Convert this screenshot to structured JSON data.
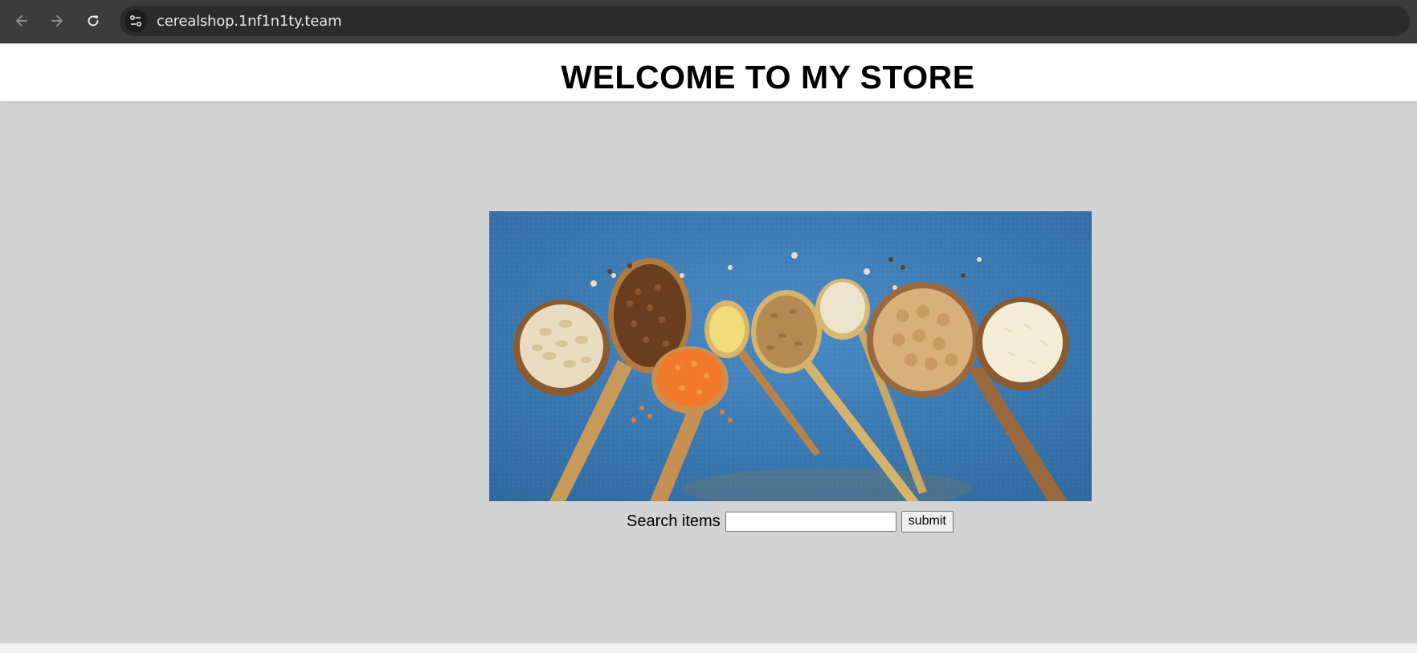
{
  "browser": {
    "url": "cerealshop.1nf1n1ty.team",
    "back_icon": "arrow-left-icon",
    "forward_icon": "arrow-right-icon",
    "reload_icon": "reload-icon",
    "site_info_icon": "tune-icon"
  },
  "header": {
    "title": "WELCOME TO MY STORE"
  },
  "search": {
    "label": "Search items",
    "value": "",
    "placeholder": "",
    "submit_label": "submit"
  },
  "colors": {
    "toolbar": "#3c3c3c",
    "main_background": "#d3d3d3",
    "hero_background": "#3f7fb9"
  }
}
